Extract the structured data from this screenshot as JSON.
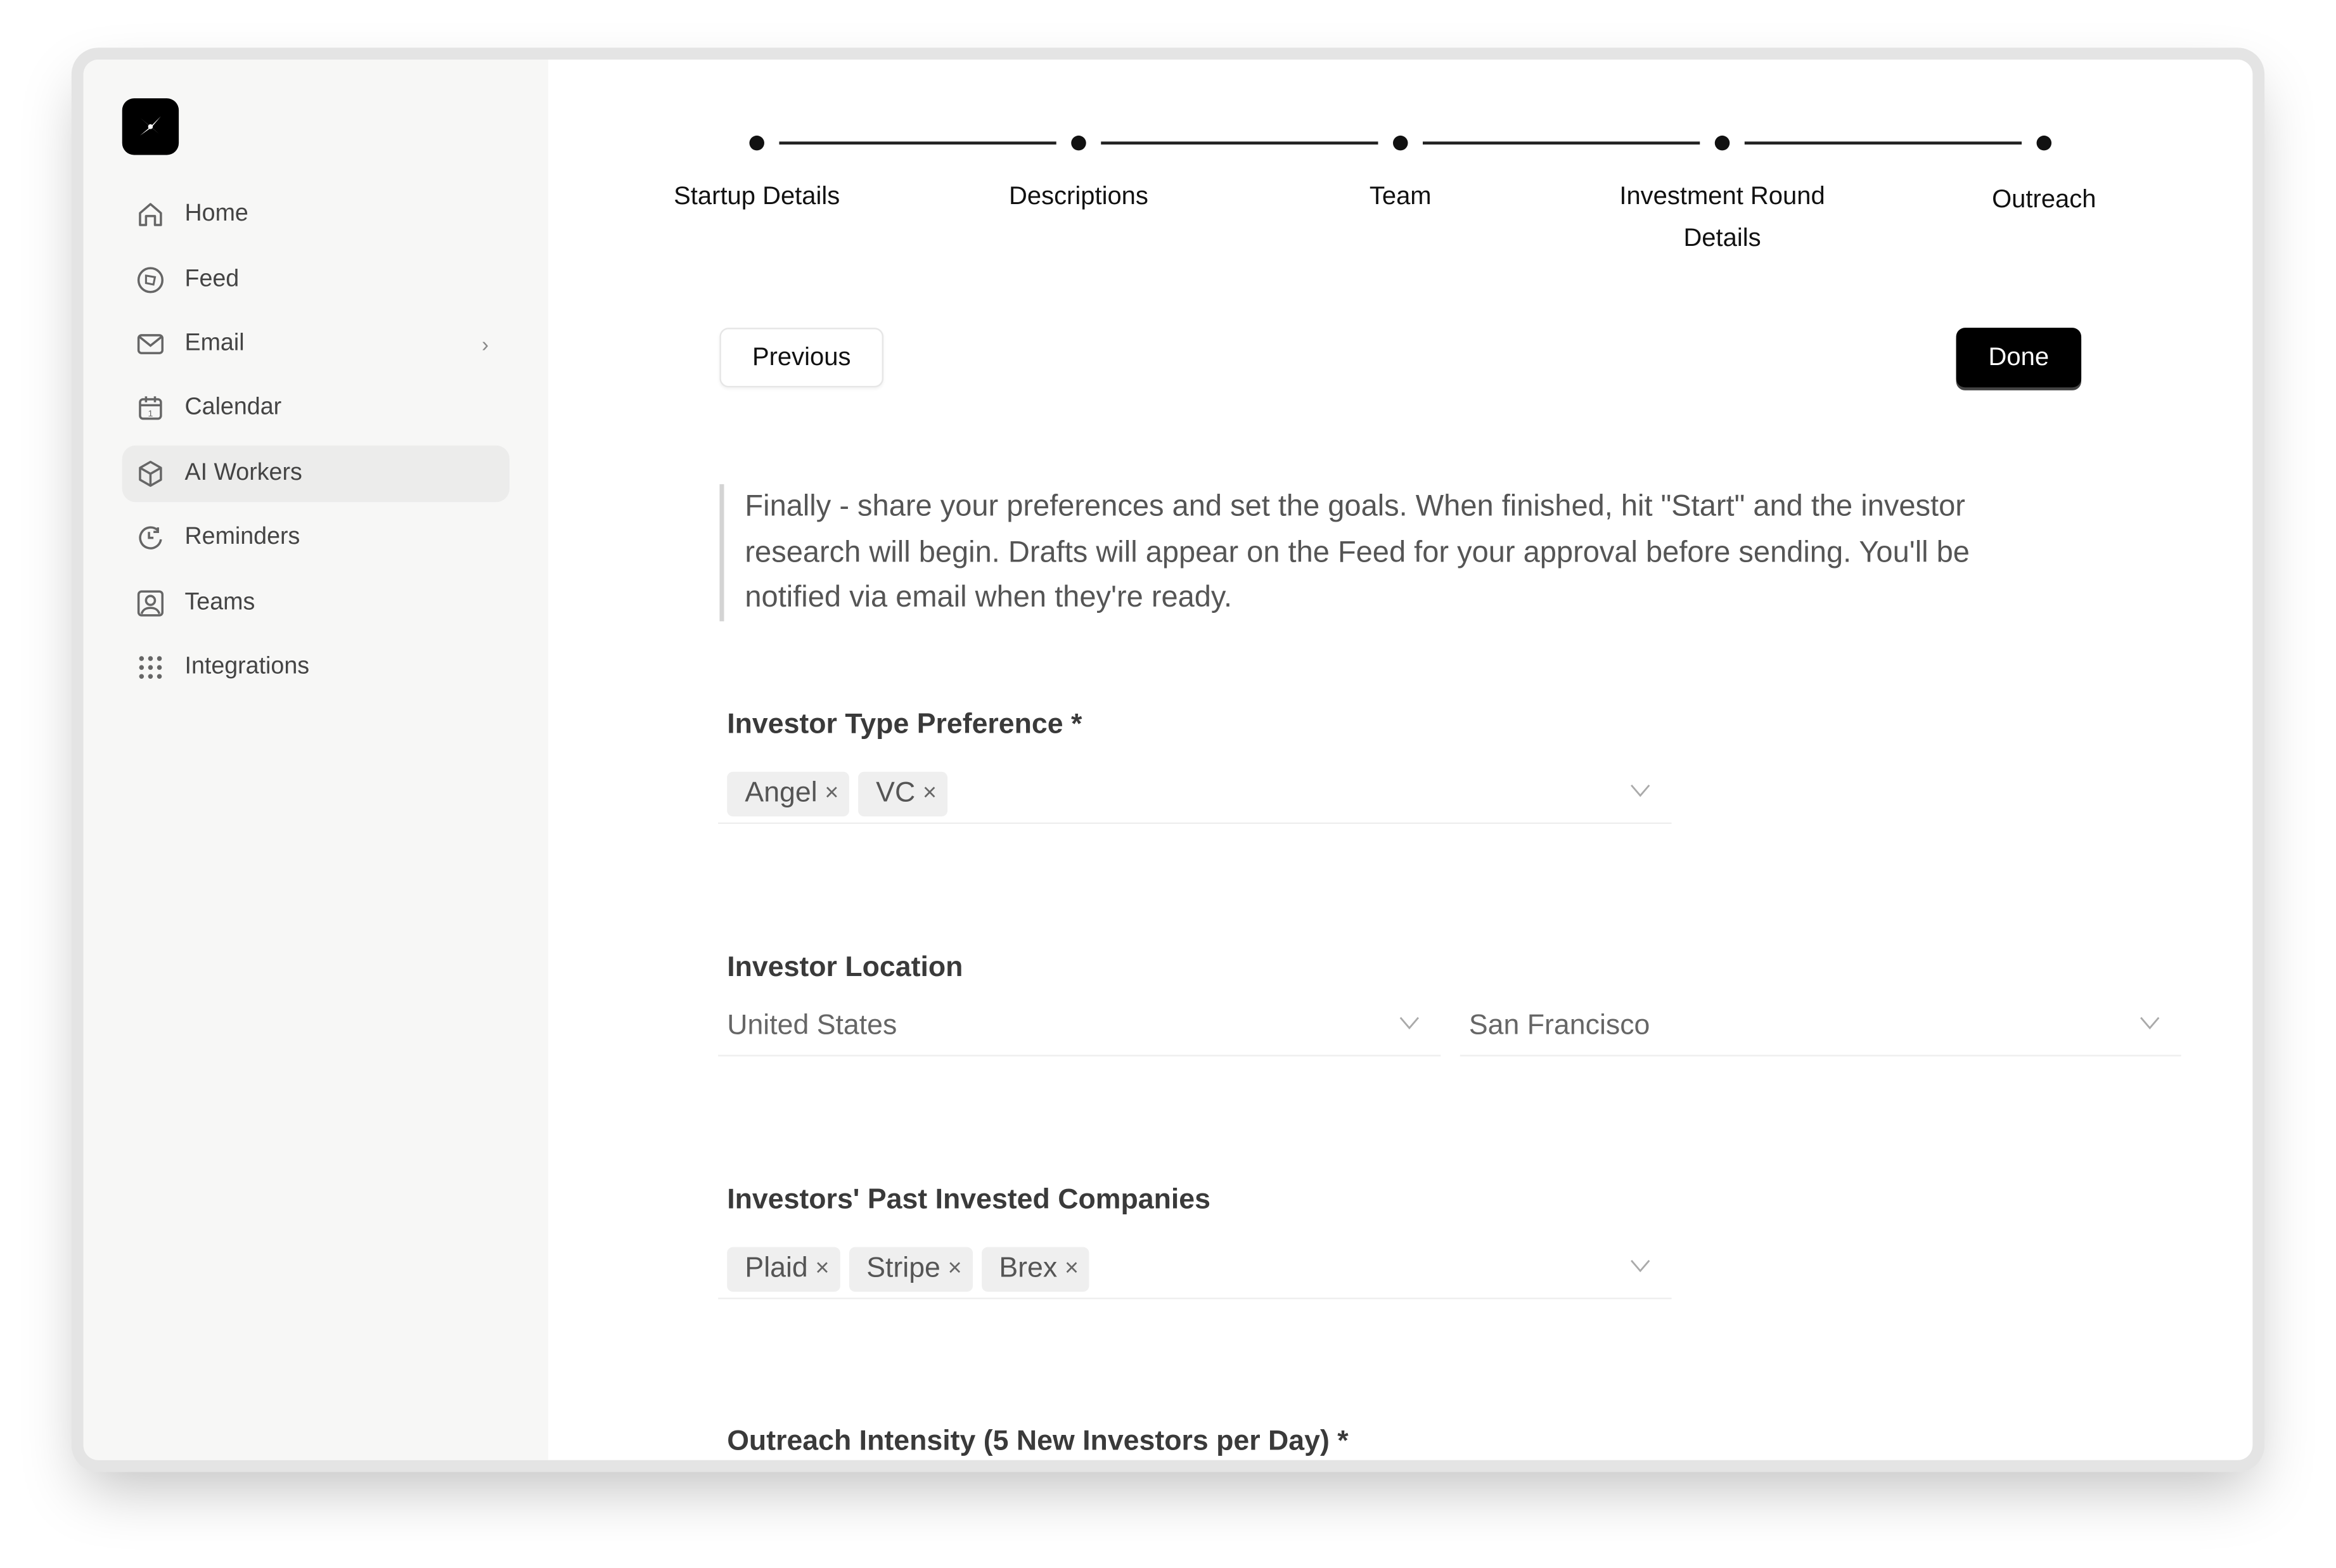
{
  "sidebar": {
    "items": [
      {
        "label": "Home",
        "icon": "home-icon"
      },
      {
        "label": "Feed",
        "icon": "compass-icon"
      },
      {
        "label": "Email",
        "icon": "mail-icon",
        "chevron": "›"
      },
      {
        "label": "Calendar",
        "icon": "calendar-icon"
      },
      {
        "label": "AI Workers",
        "icon": "cube-icon",
        "active": true
      },
      {
        "label": "Reminders",
        "icon": "clock-icon"
      },
      {
        "label": "Teams",
        "icon": "user-square-icon"
      },
      {
        "label": "Integrations",
        "icon": "grid-dots-icon"
      }
    ]
  },
  "stepper": {
    "steps": [
      "Startup Details",
      "Descriptions",
      "Team",
      "Investment Round Details",
      "Outreach"
    ]
  },
  "actions": {
    "previous": "Previous",
    "done": "Done"
  },
  "intro": "Finally - share your preferences and set the goals. When finished, hit \"Start\" and the investor research will begin. Drafts will appear on the Feed for your approval before sending. You'll be notified via email when they're ready.",
  "form": {
    "investor_type": {
      "label": "Investor Type Preference *",
      "tags": [
        "Angel",
        "VC"
      ]
    },
    "location": {
      "label": "Investor Location",
      "country": "United States",
      "city": "San Francisco"
    },
    "past_companies": {
      "label": "Investors' Past Invested Companies",
      "tags": [
        "Plaid",
        "Stripe",
        "Brex"
      ]
    },
    "intensity": {
      "label": "Outreach Intensity (5 New Investors per Day) *"
    }
  },
  "chip_remove": "×"
}
